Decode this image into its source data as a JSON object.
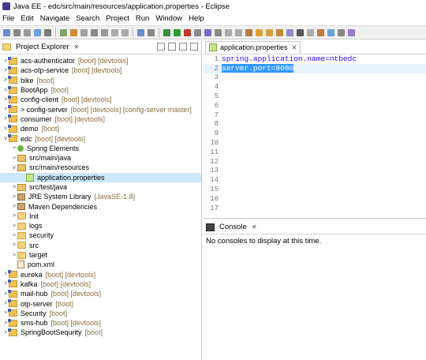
{
  "window": {
    "title": "Java EE - edc/src/main/resources/application.properties - Eclipse"
  },
  "menu": [
    "File",
    "Edit",
    "Navigate",
    "Search",
    "Project",
    "Run",
    "Window",
    "Help"
  ],
  "explorer": {
    "tab_label": "Project Explorer",
    "close_glyph": "✕",
    "items": [
      {
        "indent": 0,
        "chevron": ">",
        "icon": "project-icon",
        "label": "acs-authenticator",
        "decoration": "[boot] [devtools]"
      },
      {
        "indent": 0,
        "chevron": ">",
        "icon": "project-icon",
        "label": "acs-otp-service",
        "decoration": "[boot] [devtools]"
      },
      {
        "indent": 0,
        "chevron": ">",
        "icon": "project-icon",
        "label": "bike",
        "decoration": "[boot]"
      },
      {
        "indent": 0,
        "chevron": ">",
        "icon": "project-icon",
        "label": "BootApp",
        "decoration": "[boot]"
      },
      {
        "indent": 0,
        "chevron": ">",
        "icon": "project-icon",
        "label": "config-client",
        "decoration": "[boot] [devtools]"
      },
      {
        "indent": 0,
        "chevron": ">",
        "icon": "project-icon",
        "label": "> config-server",
        "decoration": "[boot] [devtools]  [config-server master]"
      },
      {
        "indent": 0,
        "chevron": ">",
        "icon": "project-icon",
        "label": "consumer",
        "decoration": "[boot] [devtools]"
      },
      {
        "indent": 0,
        "chevron": ">",
        "icon": "project-icon",
        "label": "demo",
        "decoration": "[boot]"
      },
      {
        "indent": 0,
        "chevron": "v",
        "icon": "project-icon",
        "label": "edc",
        "decoration": "[boot] [devtools]"
      },
      {
        "indent": 1,
        "chevron": ">",
        "icon": "spring-icon",
        "label": "Spring Elements",
        "decoration": ""
      },
      {
        "indent": 1,
        "chevron": ">",
        "icon": "package-folder-icon",
        "label": "src/main/java",
        "decoration": ""
      },
      {
        "indent": 1,
        "chevron": "v",
        "icon": "package-folder-icon",
        "label": "src/main/resources",
        "decoration": ""
      },
      {
        "indent": 2,
        "chevron": "",
        "icon": "properties-file-icon",
        "label": "application.properties",
        "decoration": "",
        "selected": true
      },
      {
        "indent": 1,
        "chevron": ">",
        "icon": "package-folder-icon",
        "label": "src/test/java",
        "decoration": ""
      },
      {
        "indent": 1,
        "chevron": ">",
        "icon": "library-icon",
        "label": "JRE System Library",
        "decoration": "[JavaSE-1.8]"
      },
      {
        "indent": 1,
        "chevron": ">",
        "icon": "library-icon",
        "label": "Maven Dependencies",
        "decoration": ""
      },
      {
        "indent": 1,
        "chevron": ">",
        "icon": "folder-icon",
        "label": "Init",
        "decoration": ""
      },
      {
        "indent": 1,
        "chevron": ">",
        "icon": "folder-icon",
        "label": "logs",
        "decoration": ""
      },
      {
        "indent": 1,
        "chevron": ">",
        "icon": "folder-icon",
        "label": "security",
        "decoration": ""
      },
      {
        "indent": 1,
        "chevron": ">",
        "icon": "folder-icon",
        "label": "src",
        "decoration": ""
      },
      {
        "indent": 1,
        "chevron": ">",
        "icon": "folder-icon",
        "label": "target",
        "decoration": ""
      },
      {
        "indent": 1,
        "chevron": "",
        "icon": "xml-file-icon",
        "label": "pom.xml",
        "decoration": ""
      },
      {
        "indent": 0,
        "chevron": ">",
        "icon": "project-icon",
        "label": "eureka",
        "decoration": "[boot] [devtools]"
      },
      {
        "indent": 0,
        "chevron": ">",
        "icon": "project-icon",
        "label": "kafka",
        "decoration": "[boot] [devtools]"
      },
      {
        "indent": 0,
        "chevron": ">",
        "icon": "project-icon",
        "label": "mail-hub",
        "decoration": "[boot] [devtools]"
      },
      {
        "indent": 0,
        "chevron": ">",
        "icon": "project-icon",
        "label": "otp-server",
        "decoration": "[boot]"
      },
      {
        "indent": 0,
        "chevron": ">",
        "icon": "project-icon",
        "label": "Security",
        "decoration": "[boot]"
      },
      {
        "indent": 0,
        "chevron": ">",
        "icon": "project-icon",
        "label": "sms-hub",
        "decoration": "[boot] [devtools]"
      },
      {
        "indent": 0,
        "chevron": ">",
        "icon": "project-icon",
        "label": "SpringBootSequrity",
        "decoration": "[boot]"
      }
    ]
  },
  "editor": {
    "tab_label": "application.properties",
    "close_glyph": "✕",
    "lines": [
      {
        "n": "1",
        "text": "spring.application.name=ntbedc",
        "highlight": false
      },
      {
        "n": "2",
        "text": "server.port=8080",
        "highlight": true
      },
      {
        "n": "3",
        "text": "",
        "highlight": false
      },
      {
        "n": "4",
        "text": "",
        "highlight": false
      },
      {
        "n": "5",
        "text": "",
        "highlight": false
      },
      {
        "n": "6",
        "text": "",
        "highlight": false
      },
      {
        "n": "7",
        "text": "",
        "highlight": false
      },
      {
        "n": "8",
        "text": "",
        "highlight": false
      },
      {
        "n": "9",
        "text": "",
        "highlight": false
      },
      {
        "n": "10",
        "text": "",
        "highlight": false
      },
      {
        "n": "11",
        "text": "",
        "highlight": false
      },
      {
        "n": "12",
        "text": "",
        "highlight": false
      },
      {
        "n": "13",
        "text": "",
        "highlight": false
      },
      {
        "n": "14",
        "text": "",
        "highlight": false
      },
      {
        "n": "15",
        "text": "",
        "highlight": false
      },
      {
        "n": "16",
        "text": "",
        "highlight": false
      },
      {
        "n": "17",
        "text": "",
        "highlight": false
      }
    ]
  },
  "console": {
    "tab_label": "Console",
    "close_glyph": "✕",
    "message": "No consoles to display at this time."
  },
  "colors": {
    "selection": "#cce8ff",
    "highlight": "#3399ff",
    "decoration": "#8a6d3b",
    "property_text": "#2a00ff"
  }
}
